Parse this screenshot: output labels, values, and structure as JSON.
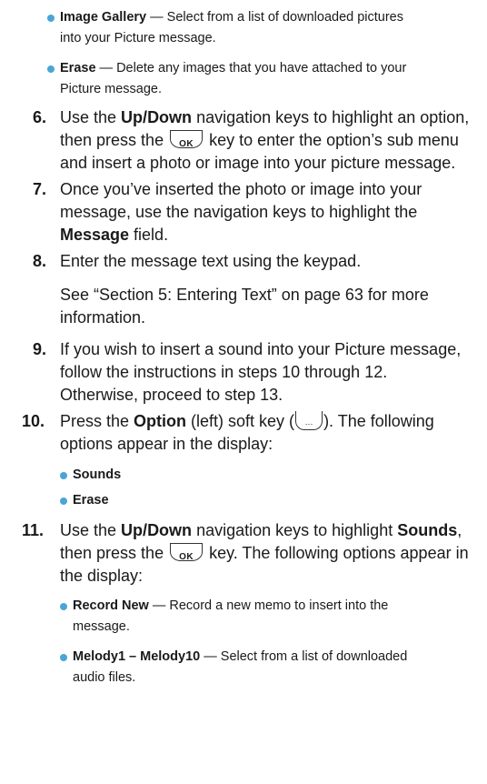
{
  "top_bullets": [
    {
      "term": "Image Gallery",
      "sep": " — ",
      "text": "Select from a list of downloaded pictures",
      "cont": "into your Picture message."
    },
    {
      "term": "Erase",
      "sep": " — ",
      "text": "Delete any images that you have attached to your",
      "cont": "Picture message."
    }
  ],
  "step6": {
    "num": "6.",
    "l1_pre": "Use the ",
    "l1_b1": "Up",
    "l1_slash": "/",
    "l1_b2": "Down",
    "l1_post": " navigation keys to highlight an option,",
    "l2_pre": "then press the ",
    "l2_key": "OK",
    "l2_post": " key to enter the option’s sub menu",
    "l3": "and insert a photo or image into your picture message."
  },
  "step7": {
    "num": "7.",
    "l1": "Once you’ve inserted the photo or image into your",
    "l2": "message, use the navigation keys to highlight the",
    "l3_b": "Message",
    "l3_post": " field."
  },
  "step8": {
    "num": "8.",
    "l1": "Enter the message text using the keypad.",
    "p1": "See “Section 5: Entering Text” on page 63 for more",
    "p2": "information."
  },
  "step9": {
    "num": "9.",
    "l1": "If you wish to insert a sound into your Picture message,",
    "l2": "follow the instructions in steps 10 through 12.",
    "l3": "Otherwise, proceed to step 13."
  },
  "step10": {
    "num": "10.",
    "l1_pre": "Press the ",
    "l1_b": "Option",
    "l1_mid": " (left) soft key (",
    "l1_key": "···",
    "l1_post": "). The following",
    "l2": "options appear in the display:",
    "items": [
      "Sounds",
      "Erase"
    ]
  },
  "step11": {
    "num": "11.",
    "l1_pre": "Use the ",
    "l1_b1": "Up",
    "l1_slash": "/",
    "l1_b2": "Down",
    "l1_mid": " navigation keys to highlight ",
    "l1_b3": "Sounds",
    "l1_post": ",",
    "l2_pre": "then press the ",
    "l2_key": "OK",
    "l2_post": " key. The following options appear in",
    "l3": "the display:",
    "items": [
      {
        "term": "Record New",
        "sep": " — ",
        "text": "Record a new memo to insert into the",
        "cont": "message."
      },
      {
        "term": "Melody1 – Melody10",
        "sep": " — ",
        "text": "Select from a list of downloaded",
        "cont": "audio files."
      }
    ]
  },
  "colors": {
    "bullet": "#4aa5d6",
    "text": "#1a1a1a"
  }
}
